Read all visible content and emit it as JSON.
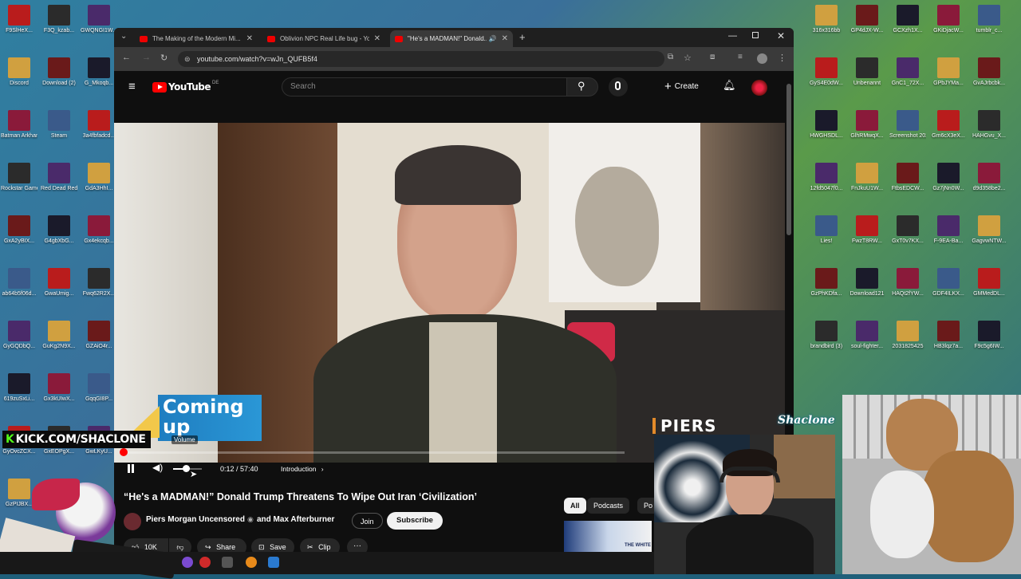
{
  "desktop": {
    "left_icons": [
      {
        "label": "F9SlHeX..."
      },
      {
        "label": "F3Q_kzab..."
      },
      {
        "label": "GWQNGI1W..."
      },
      {
        "label": "Discord"
      },
      {
        "label": "Download (2)"
      },
      {
        "label": "G_Mkoqb..."
      },
      {
        "label": "Batman Arkham As..."
      },
      {
        "label": "Steam"
      },
      {
        "label": "3a4fbfadcd..."
      },
      {
        "label": "Rockstar Games..."
      },
      {
        "label": "Red Dead Redempti..."
      },
      {
        "label": "GdA3HhI..."
      },
      {
        "label": "GxA2yBIX..."
      },
      {
        "label": "G4gbXbG..."
      },
      {
        "label": "Gx4ekcqb..."
      },
      {
        "label": "ab64b5f06d..."
      },
      {
        "label": "GwaUmig..."
      },
      {
        "label": "Fwq62R2X..."
      },
      {
        "label": "GyGQDbQ..."
      },
      {
        "label": "GuKg2N9X..."
      },
      {
        "label": "GZAiO4r..."
      },
      {
        "label": "619zuSxLi..."
      },
      {
        "label": "Gx3kUIwX..."
      },
      {
        "label": "GqqGI8P..."
      },
      {
        "label": "GyOvcZCX..."
      },
      {
        "label": "GxEOPgX..."
      },
      {
        "label": "GwLKyU..."
      },
      {
        "label": "GzPIJBX..."
      }
    ],
    "right_icons": [
      {
        "label": "316x316bb"
      },
      {
        "label": "GP4dJX-W..."
      },
      {
        "label": "GCXzh1X..."
      },
      {
        "label": "GKiDjacW..."
      },
      {
        "label": "tumblr_c..."
      },
      {
        "label": "GyS4E0dW..."
      },
      {
        "label": "Unbenannt"
      },
      {
        "label": "GnC1_72X..."
      },
      {
        "label": "GPbJYMa..."
      },
      {
        "label": "GvAJrbcbk..."
      },
      {
        "label": "HWGHSDL..."
      },
      {
        "label": "GlhRMwqX..."
      },
      {
        "label": "Screenshot 2023-06-..."
      },
      {
        "label": "Gm6cX3eX..."
      },
      {
        "label": "HAHGvu_X..."
      },
      {
        "label": "12fd5047f0..."
      },
      {
        "label": "FnJkuU1W..."
      },
      {
        "label": "FtbsEDCW..."
      },
      {
        "label": "Gz7jNn0W..."
      },
      {
        "label": "d9d358be2..."
      },
      {
        "label": "Lies!"
      },
      {
        "label": "FwzT8RW..."
      },
      {
        "label": "GxT0v7KX..."
      },
      {
        "label": "F-9EA-Ba..."
      },
      {
        "label": "GagvwNTW..."
      },
      {
        "label": "GzPhKDfa..."
      },
      {
        "label": "Download121"
      },
      {
        "label": "HAQt2fYW..."
      },
      {
        "label": "GDF4ILKX..."
      },
      {
        "label": "GMMedDL..."
      },
      {
        "label": "brandbird (3)"
      },
      {
        "label": "soul-fighter..."
      },
      {
        "label": "2031825425"
      },
      {
        "label": "HB3lqz7a..."
      },
      {
        "label": "F9c5g6IW..."
      }
    ]
  },
  "browser": {
    "tabs": [
      {
        "title": "The Making of the Modern Mi..."
      },
      {
        "title": "Oblivion NPC Real Life bug - Yo..."
      },
      {
        "title": "\"He's a MADMAN!\" Donald..."
      }
    ],
    "url": "youtube.com/watch?v=wJn_QUFB5f4"
  },
  "youtube": {
    "logo_text": "YouTube",
    "logo_region": "DE",
    "search_placeholder": "Search",
    "create_label": "Create",
    "player": {
      "overlay_main": "Coming",
      "overlay_sub": "up",
      "tooltip": "Volume",
      "time": "0:12 / 57:40",
      "chapter": "Introduction",
      "progress_percent": 0.35,
      "volume_percent": 45
    },
    "video_title": "“He's a MADMAN!” Donald Trump Threatens To Wipe Out Iran ‘Civilization’",
    "channel": "Piers Morgan Uncensored",
    "and_more": "and Max Afterburner",
    "join_label": "Join",
    "subscribe_label": "Subscribe",
    "likes": "10K",
    "share_label": "Share",
    "save_label": "Save",
    "clip_label": "Clip",
    "chips": [
      "All",
      "Podcasts",
      "Po"
    ],
    "side_thumb_text": "THE WHITE"
  },
  "overlays": {
    "kick_text": "KICK.COM/SHACLONE",
    "kick_k": "K",
    "stream_name": "Shaclone",
    "piers_text": "PIERS"
  },
  "colors": {
    "yt_red": "#ff0000",
    "kick_green": "#53fc18",
    "overlay_blue": "#1f7dc0"
  }
}
